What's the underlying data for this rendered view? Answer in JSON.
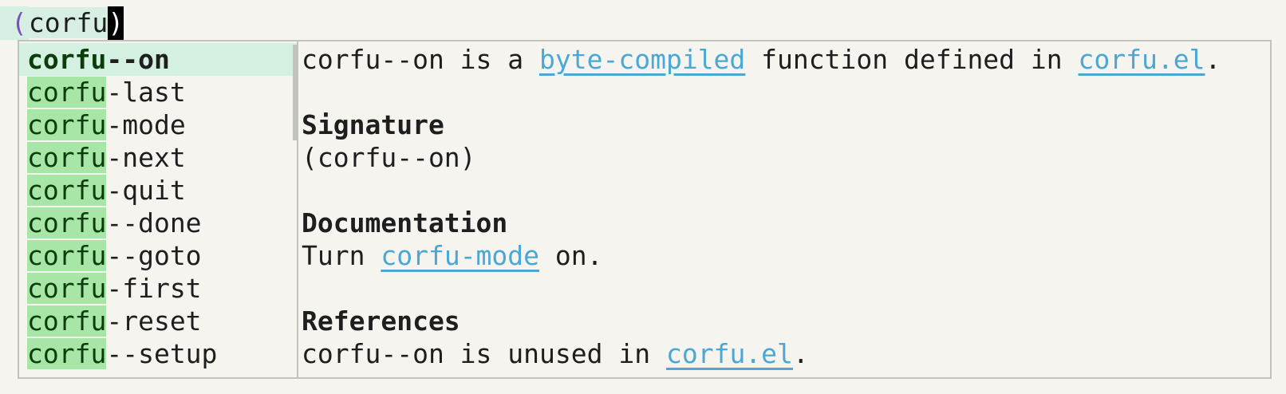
{
  "editor": {
    "open_paren": "(",
    "typed": "corfu",
    "cursor_char": ")"
  },
  "completion": {
    "typed_prefix": "corfu",
    "candidates": [
      {
        "prefix": "corfu",
        "suffix": "--on",
        "selected": true
      },
      {
        "prefix": "corfu",
        "suffix": "-last"
      },
      {
        "prefix": "corfu",
        "suffix": "-mode"
      },
      {
        "prefix": "corfu",
        "suffix": "-next"
      },
      {
        "prefix": "corfu",
        "suffix": "-quit"
      },
      {
        "prefix": "corfu",
        "suffix": "--done"
      },
      {
        "prefix": "corfu",
        "suffix": "--goto"
      },
      {
        "prefix": "corfu",
        "suffix": "-first"
      },
      {
        "prefix": "corfu",
        "suffix": "-reset"
      },
      {
        "prefix": "corfu",
        "suffix": "--setup"
      }
    ]
  },
  "doc": {
    "line1_pre": "corfu--on is a ",
    "line1_link1": "byte-compiled",
    "line1_mid": " function defined in ",
    "line1_link2": "corfu.el",
    "line1_post": ".",
    "signature_heading": "Signature",
    "signature": "(corfu--on)",
    "documentation_heading": "Documentation",
    "doc_pre": "Turn ",
    "doc_link": "corfu-mode",
    "doc_post": " on.",
    "references_heading": "References",
    "ref_pre": "corfu--on is unused in ",
    "ref_link": "corfu.el",
    "ref_post": "."
  },
  "colors": {
    "background": "#f5f4ee",
    "match_highlight": "#a8e6a8",
    "selection": "#d4f0e0",
    "link": "#4aa7d6",
    "paren": "#7b4fc2"
  }
}
